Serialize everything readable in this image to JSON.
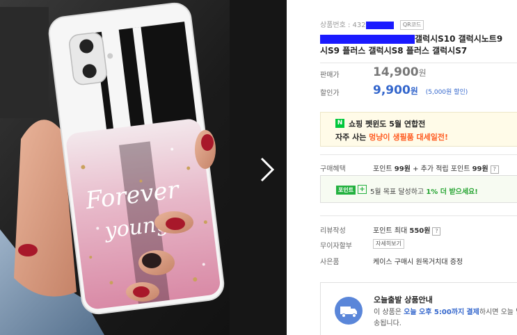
{
  "product": {
    "id_label": "상품번호 : 432",
    "qr_label": "QR코드",
    "title_line1": "갤럭시S10 갤럭시노트9 ",
    "title_line2": "시S9 플러스 갤럭시S8 플러스 갤럭시S7"
  },
  "price": {
    "list_label": "판매가",
    "list_price": "14,900",
    "won": "원",
    "sale_label": "할인가",
    "sale_price": "9,900",
    "discount_note": "(5,000원 할인)"
  },
  "promo": {
    "badge": "N",
    "line1": "쇼핑 펫윈도 5월 연합전",
    "line2_pre": "자주 사는 ",
    "line2_hl": "멍냥이 생필품 대세일전!"
  },
  "benefits": {
    "purchase_label": "구매혜택",
    "purchase_pre": "포인트 ",
    "purchase_p1": "99원",
    "purchase_mid": " + 추가 적립 포인트 ",
    "purchase_p2": "99원",
    "q_mark": "?"
  },
  "point_box": {
    "tag": "포인트",
    "plus": "+",
    "text_pre": "5월 목표 달성하고 ",
    "text_hl": "1% 더 받으세요!"
  },
  "review": {
    "label": "리뷰작성",
    "pre": "포인트 최대 ",
    "amount": "550원"
  },
  "installment": {
    "label": "무이자할부",
    "button": "자세히보기"
  },
  "gift": {
    "label": "사은품",
    "value": "케이스 구매시 원목거치대 증정"
  },
  "shipping": {
    "title": "오늘출발 상품안내",
    "desc_pre": "이 상품은 ",
    "desc_hl1": "오늘 오후 5:00까지",
    "desc_hl2": "결제",
    "desc_post": "하시면 오늘 발송됩니다."
  },
  "phone_case": {
    "script_line1": "Forever",
    "script_line2": "young"
  },
  "colors": {
    "sale_blue": "#3366cc",
    "naver_green": "#00c73c",
    "promo_orange": "#ff5a1f",
    "redaction": "#1a1aff"
  }
}
